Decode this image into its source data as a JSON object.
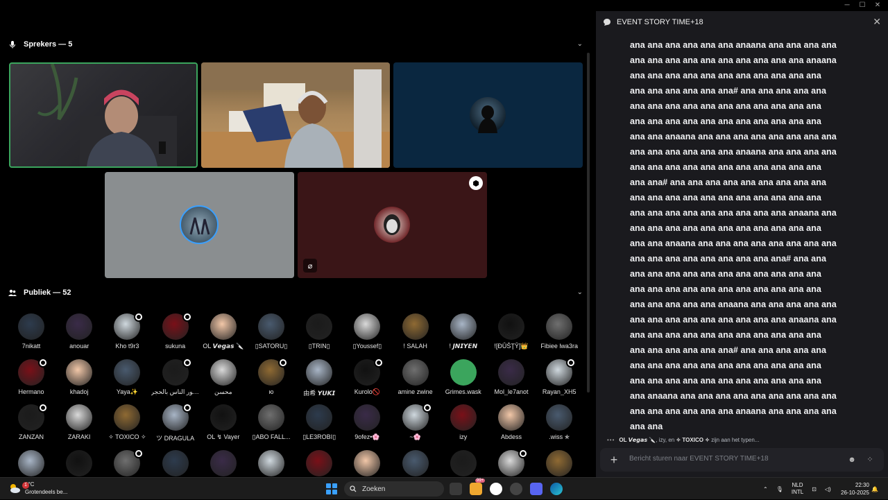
{
  "speakers": {
    "label": "Sprekers — 5"
  },
  "audience": {
    "label": "Publiek — 52",
    "rows": [
      [
        "7nikatt",
        "anouar",
        "Kho t9r3",
        "sukuna",
        "OL 𝙑𝙚𝙜𝙖𝙨 🔪",
        "▯SATORU▯",
        "▯TRIN▯",
        "▯Youssef▯",
        "! SALAH",
        "! 𝙅𝙉𝙄𝙔𝙀𝙉",
        "![ĐŪŠŢŶ]👑",
        "Fibiee lwa3ra"
      ],
      [
        "Hermano",
        "khadoj",
        "Yaya✨",
        "ديور الناس بالحجر...",
        "محسن",
        "ю",
        "由希 𝙔𝙐𝙆𝙄",
        "Kurolo🚫",
        "amine zwine",
        "Grimes.wask",
        "Mol_le7anot",
        "Rayan_XH5"
      ],
      [
        "ZANZAN",
        "ZARAKI",
        "✧ TOXICO ✧",
        "ツ DRAGULA",
        "OL ↯ Vayer",
        "▯ABO FALL...",
        "▯LE3ROBI▯",
        "9ofez•🌸",
        "~🌸",
        "izy",
        "Abdess",
        ".wiss ✯"
      ],
      [
        "",
        "",
        "",
        "",
        "",
        "",
        "",
        "",
        "",
        "",
        "",
        ""
      ]
    ]
  },
  "chat": {
    "title": "EVENT STORY TIME+18",
    "lines": [
      "ana ana ana ana ana ana anaana ana ana ana ana",
      "ana ana ana ana ana ana ana ana ana ana anaana",
      "ana ana ana ana ana ana ana ana ana ana ana",
      "ana ana ana ana ana ana# ana ana ana ana ana",
      "ana ana ana ana ana ana ana ana ana ana ana",
      "ana ana ana ana ana ana ana ana ana ana ana",
      "ana ana anaana ana ana ana ana ana ana ana ana",
      "ana ana ana ana ana ana anaana ana ana ana ana",
      "ana ana ana ana ana ana ana ana ana ana ana",
      "ana ana# ana ana ana ana ana ana ana ana ana",
      "ana ana ana ana ana ana ana ana ana ana ana",
      "ana ana ana ana ana ana ana ana ana anaana ana",
      "ana ana ana ana ana ana ana ana ana ana ana",
      "ana ana anaana ana ana ana ana ana ana ana ana",
      "ana ana ana ana ana ana ana ana ana# ana ana",
      "ana ana ana ana ana ana ana ana ana ana ana",
      "ana ana ana ana ana ana ana ana ana ana ana",
      "ana ana ana ana ana anaana ana ana ana ana ana",
      "ana ana ana ana ana ana ana ana ana anaana ana",
      "ana ana ana ana ana ana ana ana ana ana ana",
      "ana ana ana ana ana ana# ana ana ana ana ana",
      "ana ana ana ana ana ana ana ana ana ana ana",
      "ana ana ana ana ana ana ana ana ana ana ana",
      "ana anaana ana ana ana ana ana ana ana ana ana",
      "ana ana ana ana ana ana anaana ana ana ana ana",
      "ana ana"
    ],
    "typing": {
      "user1": "OL 𝙑𝙚𝙜𝙖𝙨 🔪",
      "sep1": ", izy, en",
      "user3": "✧ TOXICO ✧",
      "suffix": "zijn aan het typen..."
    },
    "composer_placeholder": "Bericht sturen naar EVENT STORY TIME+18"
  },
  "taskbar": {
    "weather_temp": "9°C",
    "weather_desc": "Grotendeels be...",
    "notification_count": "1",
    "search_label": "Zoeken",
    "lang_top": "NLD",
    "lang_bottom": "INTL",
    "time": "22:30",
    "date": "26-10-2025",
    "app_badge": "99+"
  },
  "colors": {
    "chat_bg": "#1a1a1e",
    "active_speaker_border": "#3ba55d",
    "taskbar_bg": "#1c1c1c"
  }
}
